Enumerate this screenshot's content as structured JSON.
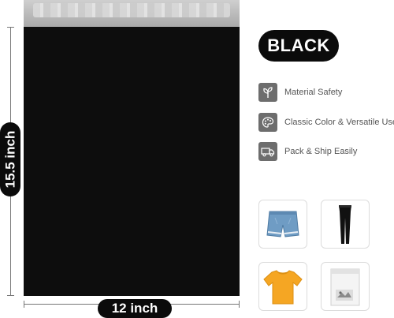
{
  "color_badge": "BLACK",
  "dimensions": {
    "height_label": "15.5 inch",
    "width_label": "12 inch"
  },
  "features": [
    {
      "label": "Material Safety",
      "icon": "leaf-sprout-icon"
    },
    {
      "label": "Classic Color & Versatile Use",
      "icon": "palette-icon"
    },
    {
      "label": "Pack & Ship Easily",
      "icon": "delivery-truck-icon"
    }
  ],
  "thumbnails": [
    {
      "icon": "denim-shorts-icon"
    },
    {
      "icon": "leggings-icon"
    },
    {
      "icon": "yellow-tshirt-icon"
    },
    {
      "icon": "open-mailer-bag-icon"
    }
  ],
  "colors": {
    "bag": "#0d0d0d",
    "strip": "#bdbdbd",
    "icon_bg": "#6d6d6d",
    "text_gray": "#555555",
    "shirt": "#f5a623",
    "denim": "#6f9cc4"
  }
}
